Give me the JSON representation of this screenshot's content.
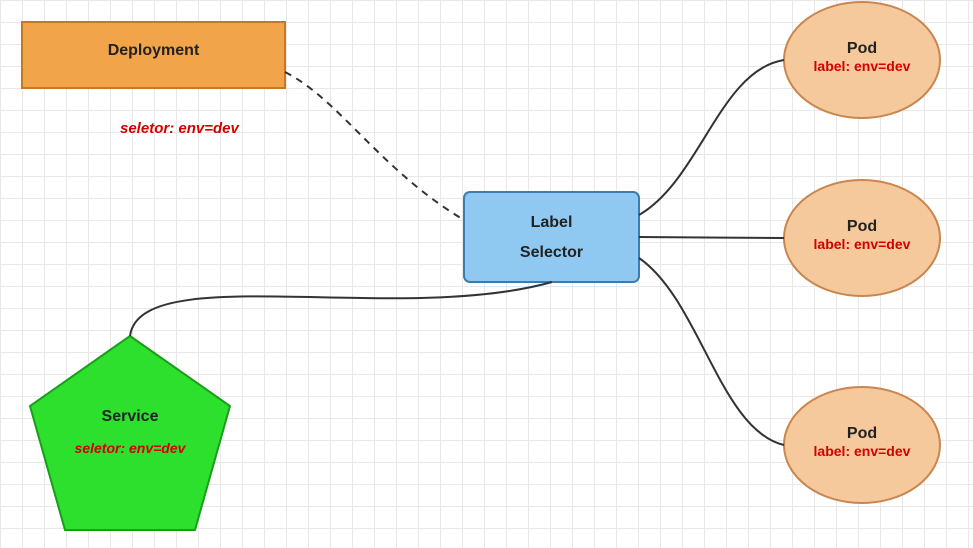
{
  "deployment": {
    "title": "Deployment"
  },
  "selector_annotation": "seletor:  env=dev",
  "label_selector": {
    "line1": "Label",
    "line2": "Selector"
  },
  "service": {
    "title": "Service",
    "sub": "seletor:  env=dev"
  },
  "pods": [
    {
      "title": "Pod",
      "sub": "label: env=dev"
    },
    {
      "title": "Pod",
      "sub": "label: env=dev"
    },
    {
      "title": "Pod",
      "sub": "label: env=dev"
    }
  ],
  "colors": {
    "deployment_fill": "#f2a44b",
    "deployment_stroke": "#c77a1d",
    "selector_fill": "#8fc9f2",
    "selector_stroke": "#3a7db0",
    "service_fill": "#2ee02e",
    "service_stroke": "#1a9e1a",
    "pod_fill": "#f5c99b",
    "pod_stroke": "#c9864f",
    "line": "#333"
  }
}
